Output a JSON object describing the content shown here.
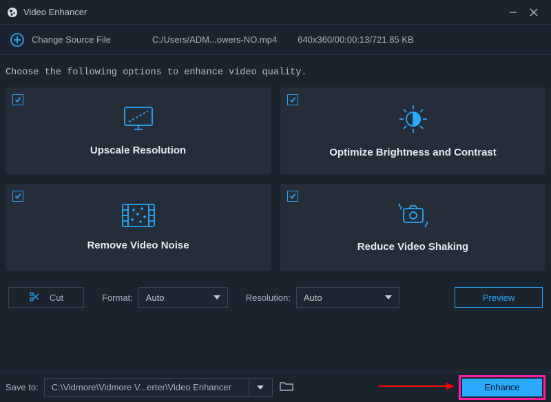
{
  "titlebar": {
    "title": "Video Enhancer"
  },
  "source": {
    "change_label": "Change Source File",
    "path": "C:/Users/ADM...owers-NO.mp4",
    "meta": "640x360/00:00:13/721.85 KB"
  },
  "instruction": "Choose the following options to enhance video quality.",
  "cards": {
    "upscale": {
      "label": "Upscale Resolution",
      "checked": true
    },
    "brightness": {
      "label": "Optimize Brightness and Contrast",
      "checked": true
    },
    "noise": {
      "label": "Remove Video Noise",
      "checked": true
    },
    "shaking": {
      "label": "Reduce Video Shaking",
      "checked": true
    }
  },
  "controls": {
    "cut_label": "Cut",
    "format_label": "Format:",
    "format_value": "Auto",
    "resolution_label": "Resolution:",
    "resolution_value": "Auto",
    "preview_label": "Preview"
  },
  "footer": {
    "save_label": "Save to:",
    "save_path": "C:\\Vidmore\\Vidmore V...erter\\Video Enhancer",
    "enhance_label": "Enhance"
  },
  "colors": {
    "accent": "#2aa9ff",
    "highlight": "#ff1ea6"
  }
}
